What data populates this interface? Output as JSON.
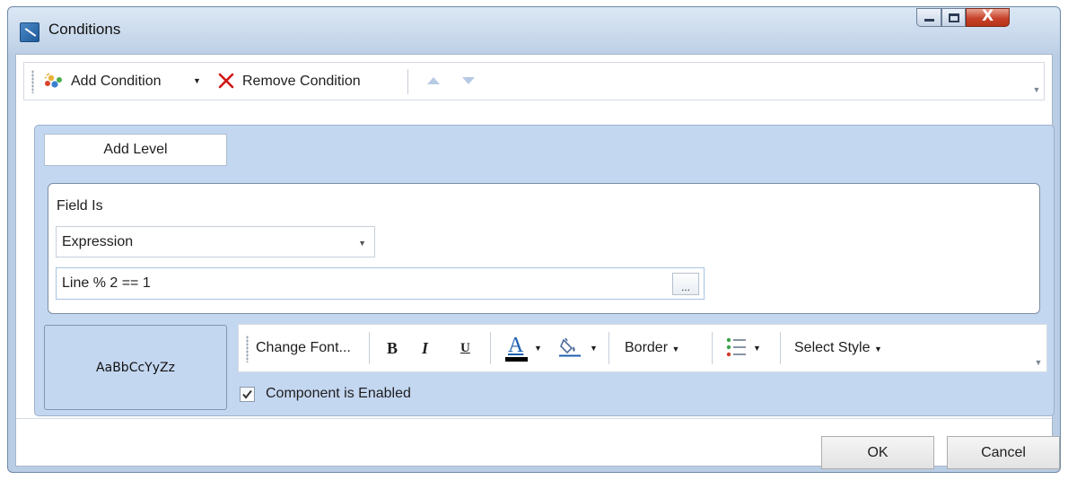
{
  "window": {
    "title": "Conditions",
    "close_glyph": "X"
  },
  "toolbar": {
    "add_condition_label": "Add Condition",
    "remove_condition_label": "Remove Condition",
    "dropdown_glyph": "▼",
    "overflow_glyph": "▼"
  },
  "condition": {
    "add_level_label": "Add Level",
    "field_is_label": "Field Is",
    "type_value": "Expression",
    "expression_value": "Line % 2 == 1",
    "ellipsis_label": "..."
  },
  "style": {
    "preview_text": "AaBbCcYyZz",
    "change_font_label": "Change Font...",
    "bold_label": "B",
    "italic_label": "I",
    "underline_label": "U",
    "font_color_label": "A",
    "border_label": "Border",
    "select_style_label": "Select Style",
    "component_enabled_label": "Component is Enabled",
    "component_enabled": true
  },
  "dialog": {
    "ok_label": "OK",
    "cancel_label": "Cancel"
  },
  "colors": {
    "panel": "#c4d7f1",
    "accent": "#1c5fb0",
    "remove_red": "#d01818"
  },
  "icons": [
    "app-icon",
    "add-condition-icon",
    "remove-icon",
    "move-up-icon",
    "move-down-icon",
    "fill-color-icon",
    "list-icon",
    "checkmark-icon"
  ]
}
